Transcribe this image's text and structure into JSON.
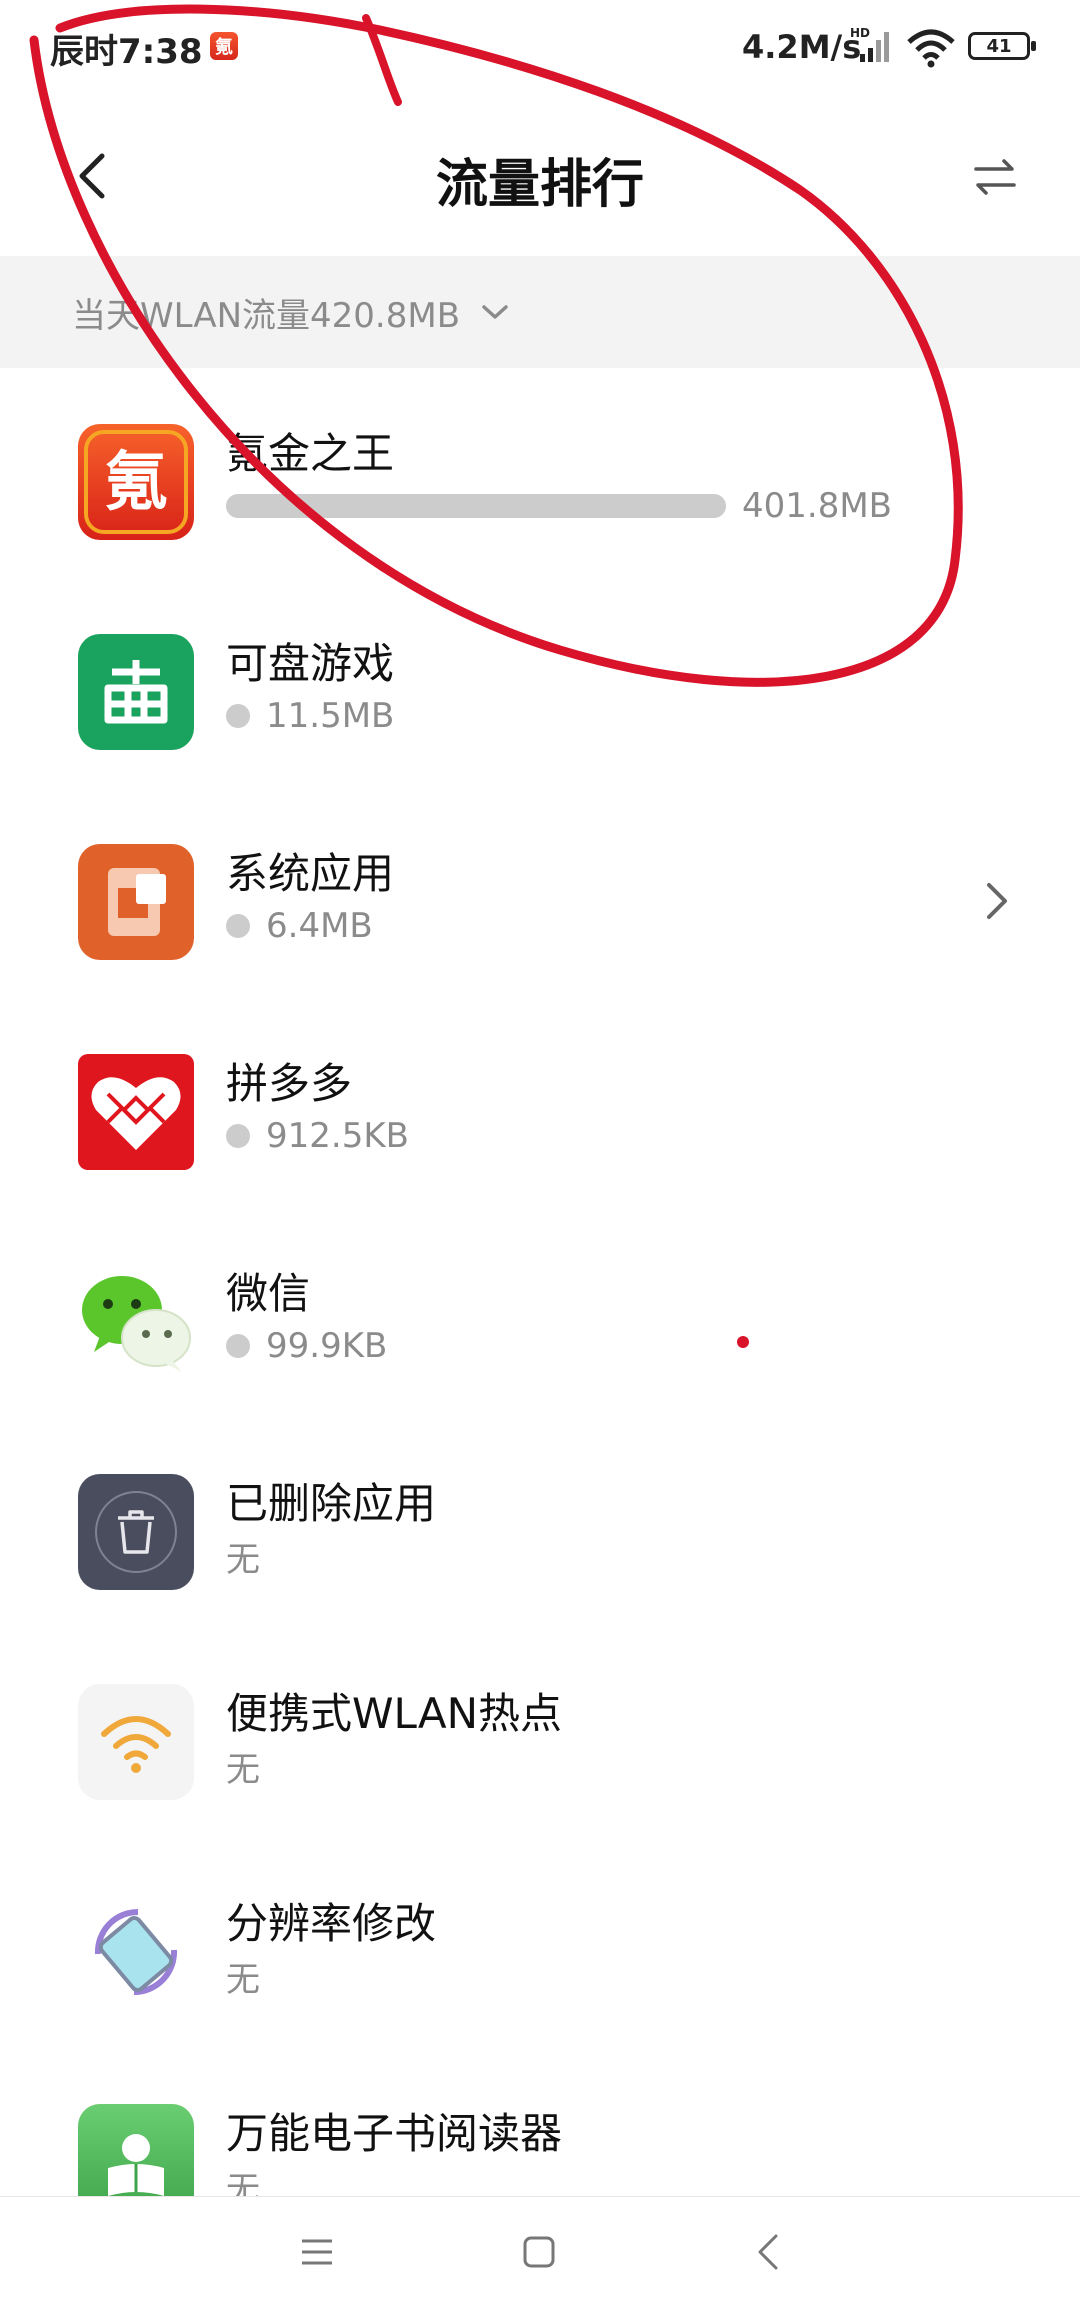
{
  "status_bar": {
    "time": "辰时7:38",
    "app_icon_glyph": "氪",
    "network_speed": "4.2M/s",
    "hd_badge": "HD",
    "battery": "41"
  },
  "header": {
    "title": "流量排行"
  },
  "filter": {
    "label": "当天WLAN流量420.8MB"
  },
  "apps": [
    {
      "name": "氪金之王",
      "usage": "401.8MB",
      "icon": "krypton-king-app-icon",
      "color": "#e8321f",
      "usage_fraction": 0.955
    },
    {
      "name": "可盘游戏",
      "usage": "11.5MB",
      "icon": "kepan-game-app-icon",
      "color": "#1aa35f"
    },
    {
      "name": "系统应用",
      "usage": "6.4MB",
      "icon": "system-apps-icon",
      "color": "#e0622a"
    },
    {
      "name": "拼多多",
      "usage": "912.5KB",
      "icon": "pinduoduo-app-icon",
      "color": "#e0161e"
    },
    {
      "name": "微信",
      "usage": "99.9KB",
      "icon": "wechat-app-icon",
      "color": "#5bc52c"
    },
    {
      "name": "已删除应用",
      "usage": "无",
      "icon": "trash-icon",
      "color": "#4a4d5e"
    },
    {
      "name": "便携式WLAN热点",
      "usage": "无",
      "icon": "hotspot-wifi-icon",
      "color": "#f0a83a"
    },
    {
      "name": "分辨率修改",
      "usage": "无",
      "icon": "resolution-phone-icon",
      "color": "#9a7fd6"
    },
    {
      "name": "万能电子书阅读器",
      "usage": "无",
      "icon": "ebook-reader-app-icon",
      "color": "#4cb45a"
    }
  ],
  "colors": {
    "annotation_red": "#d8132a",
    "secondary_text": "#8b8b8b",
    "filter_background": "#f3f3f3"
  }
}
